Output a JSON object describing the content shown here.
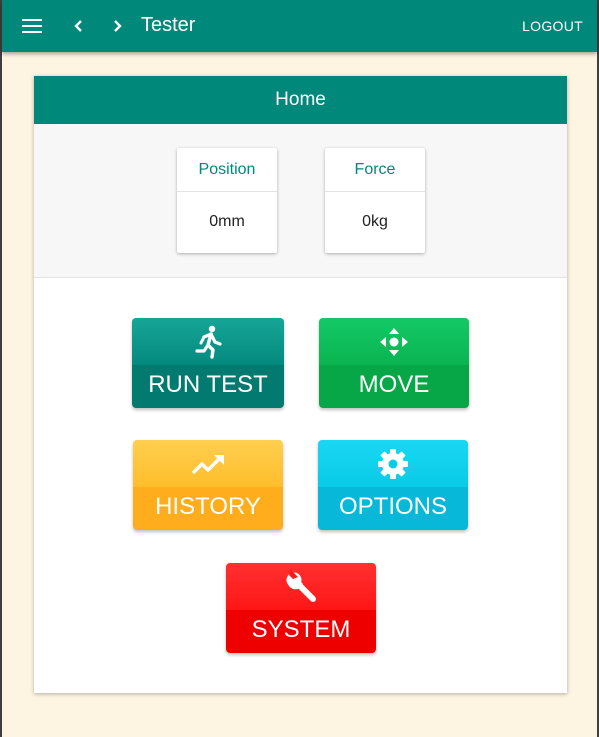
{
  "appbar": {
    "title": "Tester",
    "logout_label": "LOGOUT",
    "menu_icon": "menu-icon",
    "back_icon": "chevron-left-icon",
    "forward_icon": "chevron-right-icon",
    "color": "#00897b"
  },
  "home": {
    "title": "Home",
    "readouts": [
      {
        "label": "Position",
        "value": "0mm"
      },
      {
        "label": "Force",
        "value": "0kg"
      }
    ],
    "tiles": [
      {
        "label": "RUN TEST",
        "icon": "running-person-icon",
        "color": "#00897b"
      },
      {
        "label": "MOVE",
        "icon": "move-arrows-icon",
        "color": "#0ab451"
      },
      {
        "label": "HISTORY",
        "icon": "trending-up-icon",
        "color": "#ffb322"
      },
      {
        "label": "OPTIONS",
        "icon": "gear-icon",
        "color": "#09c6e5"
      },
      {
        "label": "SYSTEM",
        "icon": "wrench-icon",
        "color": "#ff0a0a"
      }
    ]
  }
}
